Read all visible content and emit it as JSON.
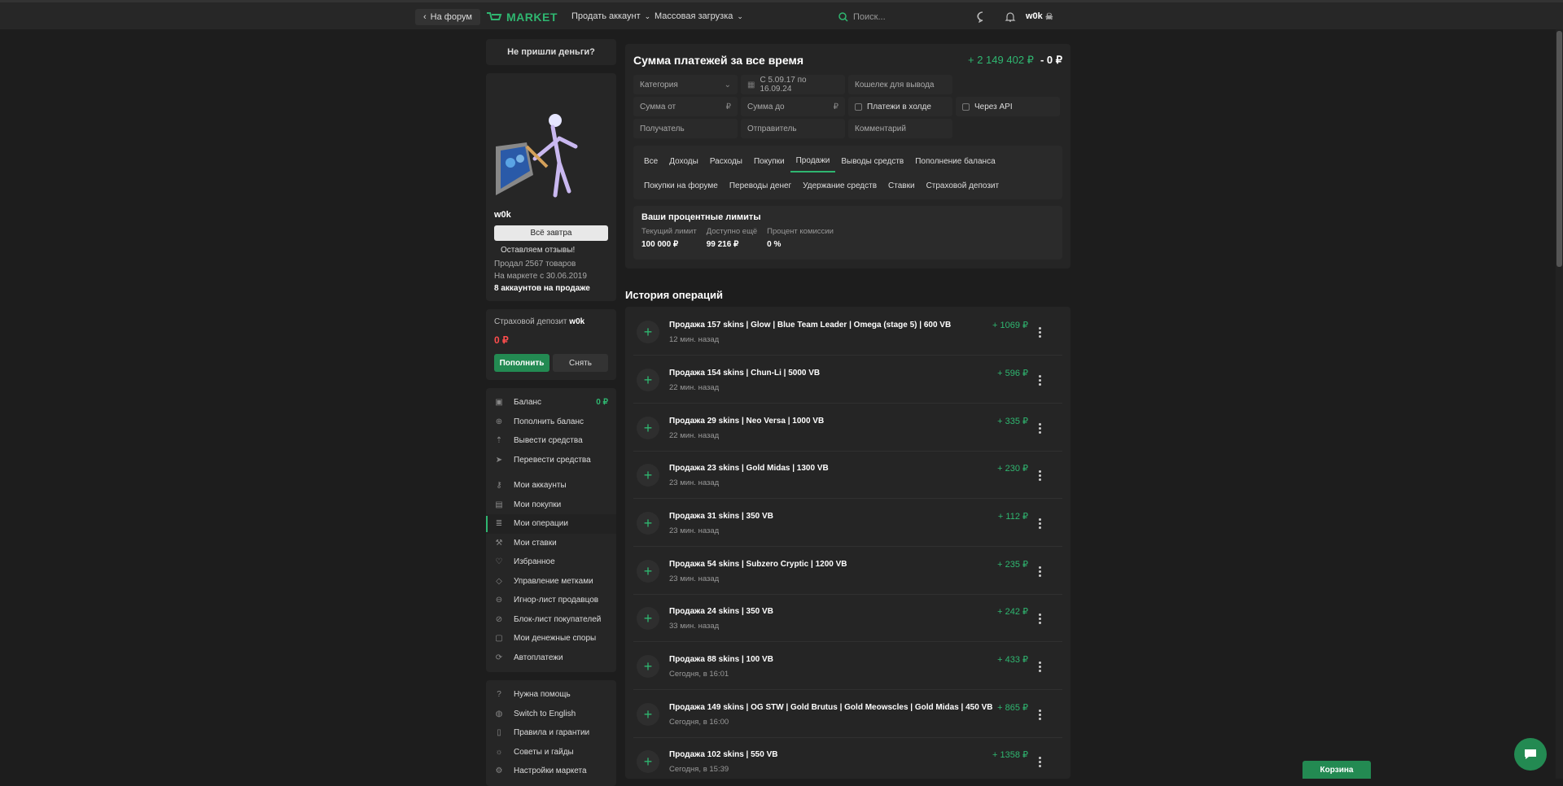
{
  "topbar": {
    "back_label": "На форум",
    "logo_text": "MARKET",
    "nav_sell": "Продать аккаунт",
    "nav_bulk": "Массовая загрузка",
    "search_placeholder": "Поиск...",
    "username": "w0k"
  },
  "sidebar": {
    "no_money_label": "Не пришли деньги?",
    "username": "w0k",
    "status_button": "Всё завтра",
    "reviews_label": "Оставляем отзывы!",
    "sold_text": "Продал 2567 товаров",
    "since_text": "На маркете с 30.06.2019",
    "accounts_on_sale": "8 аккаунтов на продаже",
    "deposit_title": "Страховой депозит",
    "deposit_user": "w0k",
    "deposit_value": "0 ₽",
    "deposit_topup": "Пополнить",
    "deposit_withdraw": "Снять",
    "menu": [
      {
        "label": "Баланс",
        "icon": "wallet-icon",
        "value": "0 ₽"
      },
      {
        "label": "Пополнить баланс",
        "icon": "add-circle-icon"
      },
      {
        "label": "Вывести средства",
        "icon": "upload-icon"
      },
      {
        "label": "Перевести средства",
        "icon": "send-icon"
      }
    ],
    "menu2": [
      {
        "label": "Мои аккаунты",
        "icon": "key-icon"
      },
      {
        "label": "Мои покупки",
        "icon": "bag-icon"
      },
      {
        "label": "Мои операции",
        "icon": "list-icon",
        "active": true
      },
      {
        "label": "Мои ставки",
        "icon": "gavel-icon"
      },
      {
        "label": "Избранное",
        "icon": "heart-icon"
      },
      {
        "label": "Управление метками",
        "icon": "tag-icon"
      },
      {
        "label": "Игнор-лист продавцов",
        "icon": "user-minus-icon"
      },
      {
        "label": "Блок-лист покупателей",
        "icon": "user-block-icon"
      },
      {
        "label": "Мои денежные споры",
        "icon": "dispute-icon"
      },
      {
        "label": "Автоплатежи",
        "icon": "autopay-icon"
      }
    ],
    "menu3": [
      {
        "label": "Нужна помощь",
        "icon": "help-icon"
      },
      {
        "label": "Switch to English",
        "icon": "globe-icon"
      },
      {
        "label": "Правила и гарантии",
        "icon": "doc-icon"
      },
      {
        "label": "Советы и гайды",
        "icon": "bulb-icon"
      },
      {
        "label": "Настройки маркета",
        "icon": "gear-icon"
      }
    ]
  },
  "summary": {
    "title": "Сумма платежей за все время",
    "plus": "+ 2 149 402 ₽",
    "minus": "- 0 ₽",
    "filters": {
      "category": "Категория",
      "date": "С 5.09.17 по 16.09.24",
      "wallet": "Кошелек для вывода",
      "sum_from": "Сумма от",
      "sum_to": "Сумма до",
      "hold": "Платежи в холде",
      "api": "Через API",
      "recipient": "Получатель",
      "sender": "Отправитель",
      "comment": "Комментарий",
      "currency": "₽"
    },
    "tabs_row1": [
      "Все",
      "Доходы",
      "Расходы",
      "Покупки",
      "Продажи",
      "Выводы средств",
      "Пополнение баланса"
    ],
    "tabs_row2": [
      "Покупки на форуме",
      "Переводы денег",
      "Удержание средств",
      "Ставки",
      "Страховой депозит"
    ],
    "limits": {
      "title": "Ваши процентные лимиты",
      "current_label": "Текущий лимит",
      "current_value": "100 000 ₽",
      "available_label": "Доступно ещё",
      "available_value": "99 216 ₽",
      "commission_label": "Процент комиссии",
      "commission_value": "0 %"
    }
  },
  "history": {
    "title": "История операций",
    "rows": [
      {
        "title": "Продажа 157 skins | Glow | Blue Team Leader | Omega (stage 5) | 600 VB",
        "time": "12 мин. назад",
        "amount": "+ 1069 ₽"
      },
      {
        "title": "Продажа 154 skins | Chun-Li | 5000 VB",
        "time": "22 мин. назад",
        "amount": "+ 596 ₽"
      },
      {
        "title": "Продажа 29 skins | Neo Versa | 1000 VB",
        "time": "22 мин. назад",
        "amount": "+ 335 ₽"
      },
      {
        "title": "Продажа 23 skins | Gold Midas | 1300 VB",
        "time": "23 мин. назад",
        "amount": "+ 230 ₽"
      },
      {
        "title": "Продажа 31 skins | 350 VB",
        "time": "23 мин. назад",
        "amount": "+ 112 ₽"
      },
      {
        "title": "Продажа 54 skins | Subzero Cryptic | 1200 VB",
        "time": "23 мин. назад",
        "amount": "+ 235 ₽"
      },
      {
        "title": "Продажа 24 skins | 350 VB",
        "time": "33 мин. назад",
        "amount": "+ 242 ₽"
      },
      {
        "title": "Продажа 88 skins | 100 VB",
        "time": "Сегодня, в 16:01",
        "amount": "+ 433 ₽"
      },
      {
        "title": "Продажа 149 skins | OG STW | Gold Brutus | Gold Meowscles | Gold Midas | 450 VB",
        "time": "Сегодня, в 16:00",
        "amount": "+ 865 ₽"
      },
      {
        "title": "Продажа 102 skins | 550 VB",
        "time": "Сегодня, в 15:39",
        "amount": "+ 1358 ₽"
      }
    ]
  },
  "cart_label": "Корзина"
}
